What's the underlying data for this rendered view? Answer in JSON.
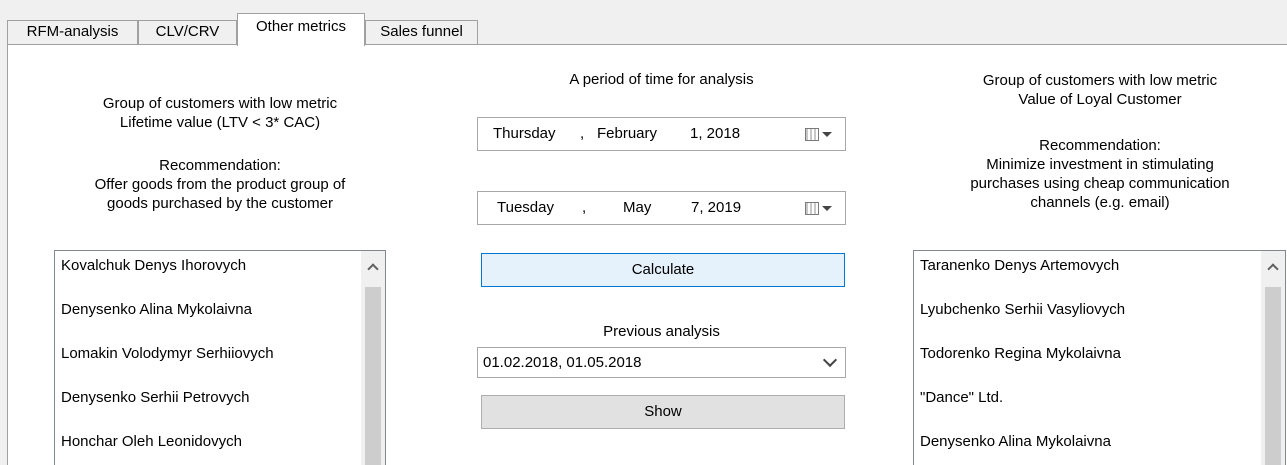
{
  "tabs": [
    {
      "label": "RFM-analysis"
    },
    {
      "label": "CLV/CRV"
    },
    {
      "label": "Other metrics"
    },
    {
      "label": "Sales funnel"
    }
  ],
  "left_group": {
    "title_line1": "Group of customers with low metric",
    "title_line2": "Lifetime value (LTV < 3* CAC)",
    "rec_title": "Recommendation:",
    "rec_line1": "Offer goods from the product group of",
    "rec_line2": "goods purchased by the customer",
    "customers": [
      "Kovalchuk Denys Ihorovych",
      "Denysenko Alina Mykolaivna",
      "Lomakin Volodymyr Serhiiovych",
      "Denysenko Serhii Petrovych",
      "Honchar Oleh Leonidovych"
    ]
  },
  "period": {
    "title": "A period of time for analysis",
    "start": {
      "weekday": "Thursday",
      "sep1": ",",
      "month": "February",
      "day_year": "1, 2018"
    },
    "end": {
      "weekday": "Tuesday",
      "sep1": ",",
      "month": "May",
      "day_year": "7, 2019"
    },
    "calculate_label": "Calculate",
    "previous_title": "Previous analysis",
    "previous_selected": "01.02.2018, 01.05.2018",
    "show_label": "Show"
  },
  "right_group": {
    "title_line1": "Group of customers with low metric",
    "title_line2": "Value of Loyal Customer",
    "rec_title": "Recommendation:",
    "rec_line1": "Minimize investment in stimulating",
    "rec_line2": "purchases using cheap communication",
    "rec_line3": "channels (e.g. email)",
    "customers": [
      "Taranenko Denys Artemovych",
      "Lyubchenko Serhii Vasyliovych",
      "Todorenko Regina Mykolaivna",
      "\"Dance\" Ltd.",
      "Denysenko Alina Mykolaivna"
    ]
  },
  "icons": {
    "calendar": "calendar-icon",
    "dropdown": "chevron-down-icon",
    "scroll_up": "chevron-up-icon"
  },
  "colors": {
    "focus_border": "#0078d7",
    "focus_fill": "#e5f1fb",
    "panel_bg": "#ffffff",
    "window_bg": "#f0f0f0"
  }
}
